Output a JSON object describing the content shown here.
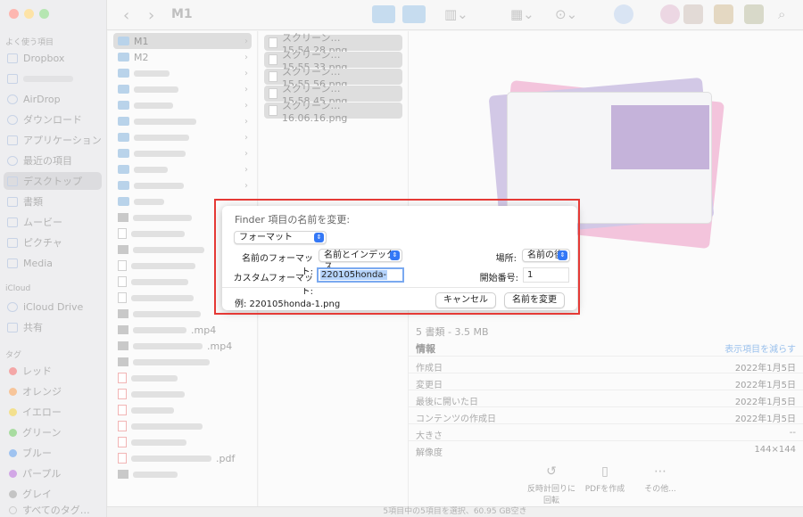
{
  "toolbar": {
    "title": "M1",
    "back": "‹",
    "forward": "›"
  },
  "sidebar": {
    "favorites_header": "よく使う項目",
    "favorites": [
      "Dropbox",
      "",
      "AirDrop",
      "ダウンロード",
      "アプリケーション",
      "最近の項目",
      "デスクトップ",
      "書類",
      "ムービー",
      "ピクチャ",
      "Media"
    ],
    "icloud_header": "iCloud",
    "icloud": [
      "iCloud Drive",
      "共有"
    ],
    "tags_header": "タグ",
    "tags": [
      "レッド",
      "オレンジ",
      "イエロー",
      "グリーン",
      "ブルー",
      "パープル",
      "グレイ",
      "すべてのタグ…"
    ],
    "tag_colors": [
      "#f4a7a7",
      "#f7c59a",
      "#f3e08e",
      "#a8dca0",
      "#9fc3f0",
      "#d2a7e6",
      "#c4c4c4"
    ]
  },
  "column1": {
    "items": [
      "M1",
      "M2"
    ],
    "suffixes": [
      ".mp4",
      ".mp4",
      ".pdf"
    ]
  },
  "files": [
    "スクリーン…15.54.28.png",
    "スクリーン…15.55.33.png",
    "スクリーン…15.55.56.png",
    "スクリーン…15.58.45.png",
    "スクリーン…16.06.16.png"
  ],
  "preview": {
    "subtitle": "5 書類 - 3.5 MB",
    "info_header": "情報",
    "show_less": "表示項目を減らす",
    "rows": [
      {
        "k": "作成日",
        "v": "2022年1月5日"
      },
      {
        "k": "変更日",
        "v": "2022年1月5日"
      },
      {
        "k": "最後に開いた日",
        "v": "2022年1月5日"
      },
      {
        "k": "コンテンツの作成日",
        "v": "2022年1月5日"
      },
      {
        "k": "大きさ",
        "v": "--"
      },
      {
        "k": "解像度",
        "v": "144×144"
      }
    ],
    "actions": [
      "反時計回りに\n回転",
      "PDFを作成",
      "その他..."
    ]
  },
  "status": "5項目中の5項目を選択、60.95 GB空き",
  "dialog": {
    "title": "Finder 項目の名前を変更:",
    "mode": "フォーマット",
    "name_format_label": "名前のフォーマット:",
    "name_format_value": "名前とインデックス",
    "where_label": "場所:",
    "where_value": "名前の後",
    "custom_format_label": "カスタムフォーマット:",
    "custom_format_value": "220105honda-",
    "start_number_label": "開始番号:",
    "start_number_value": "1",
    "example": "例: 220105honda-1.png",
    "cancel": "キャンセル",
    "rename": "名前を変更"
  }
}
